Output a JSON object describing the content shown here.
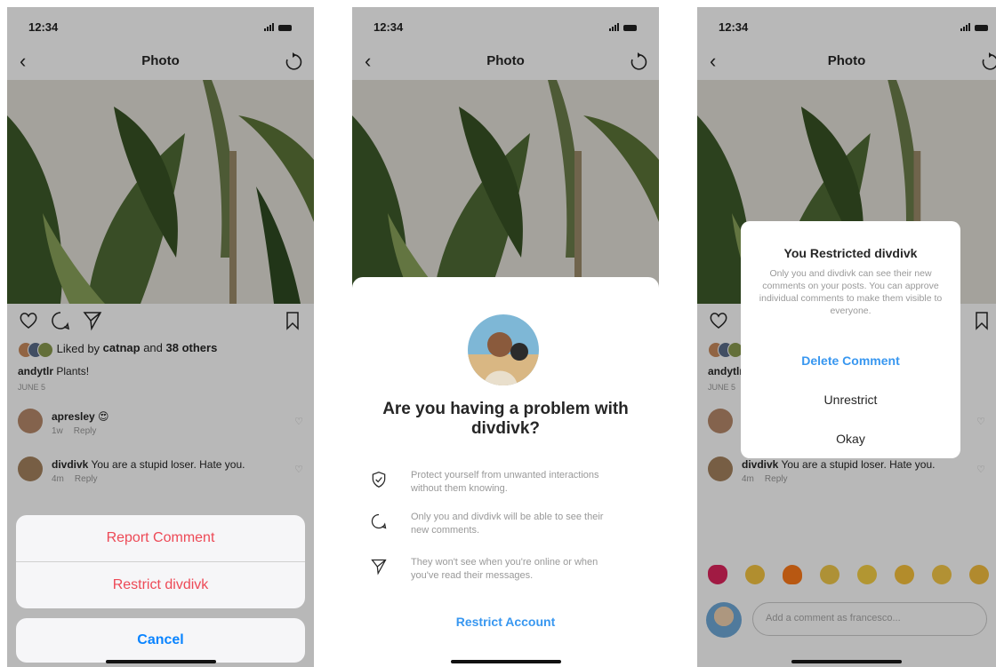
{
  "status": {
    "time": "12:34"
  },
  "nav": {
    "title": "Photo"
  },
  "post": {
    "liked_by_prefix": "Liked by ",
    "liked_by_user": "catnap",
    "liked_by_and": " and ",
    "liked_by_count": "38 others",
    "caption_user": "andytlr",
    "caption_text": " Plants!",
    "date": "JUNE 5"
  },
  "comments": [
    {
      "user": "apresley",
      "text": "😍",
      "time": "1w",
      "reply": "Reply"
    },
    {
      "user": "divdivk",
      "text": " You are a stupid loser. Hate you.",
      "time": "4m",
      "reply": "Reply"
    }
  ],
  "action_sheet": {
    "report": "Report Comment",
    "restrict": "Restrict divdivk",
    "cancel": "Cancel"
  },
  "restrict_sheet": {
    "title": "Are you having a problem with divdivk?",
    "items": [
      {
        "icon": "shield-check-icon",
        "text": "Protect yourself from unwanted interactions without them knowing."
      },
      {
        "icon": "speech-bubble-icon",
        "text": "Only you and divdivk will be able to see their new comments."
      },
      {
        "icon": "paper-plane-icon",
        "text": "They won't see when you're online or when you've read their messages."
      }
    ],
    "action": "Restrict Account"
  },
  "dialog": {
    "title": "You Restricted divdivk",
    "body": "Only you and divdivk can see their new comments on your posts. You can approve individual comments to make them visible to everyone.",
    "delete": "Delete Comment",
    "unrestrict": "Unrestrict",
    "okay": "Okay"
  },
  "comment_input": {
    "placeholder": "Add a comment as francesco..."
  },
  "emoji_bar": [
    "red-heart",
    "raised-hands",
    "fire",
    "clapping-hands",
    "crying-face",
    "heart-eyes-face",
    "surprised-face",
    "laughing-face"
  ],
  "colors": {
    "destructive": "#ed4956",
    "link": "#3897f0",
    "ios_blue": "#0a84ff"
  }
}
